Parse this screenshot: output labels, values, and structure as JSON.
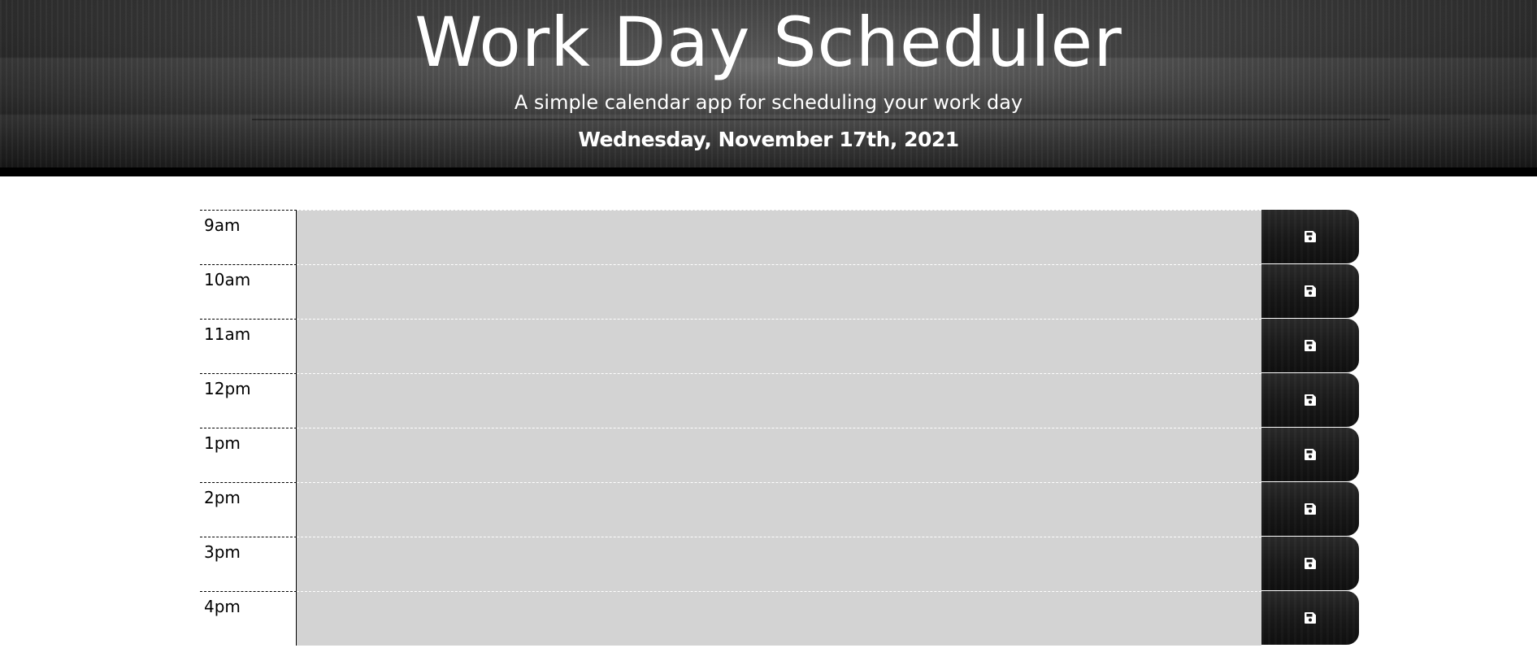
{
  "header": {
    "title": "Work Day Scheduler",
    "lead": "A simple calendar app for scheduling your work day",
    "current_day": "Wednesday, November 17th, 2021"
  },
  "hours": [
    {
      "label": "9am",
      "text": ""
    },
    {
      "label": "10am",
      "text": ""
    },
    {
      "label": "11am",
      "text": ""
    },
    {
      "label": "12pm",
      "text": ""
    },
    {
      "label": "1pm",
      "text": ""
    },
    {
      "label": "2pm",
      "text": ""
    },
    {
      "label": "3pm",
      "text": ""
    },
    {
      "label": "4pm",
      "text": ""
    }
  ],
  "icons": {
    "save": "floppy-disk-icon"
  },
  "colors": {
    "past": "#d3d3d3",
    "button": "#1a1a1a",
    "header_text": "#ffffff"
  }
}
